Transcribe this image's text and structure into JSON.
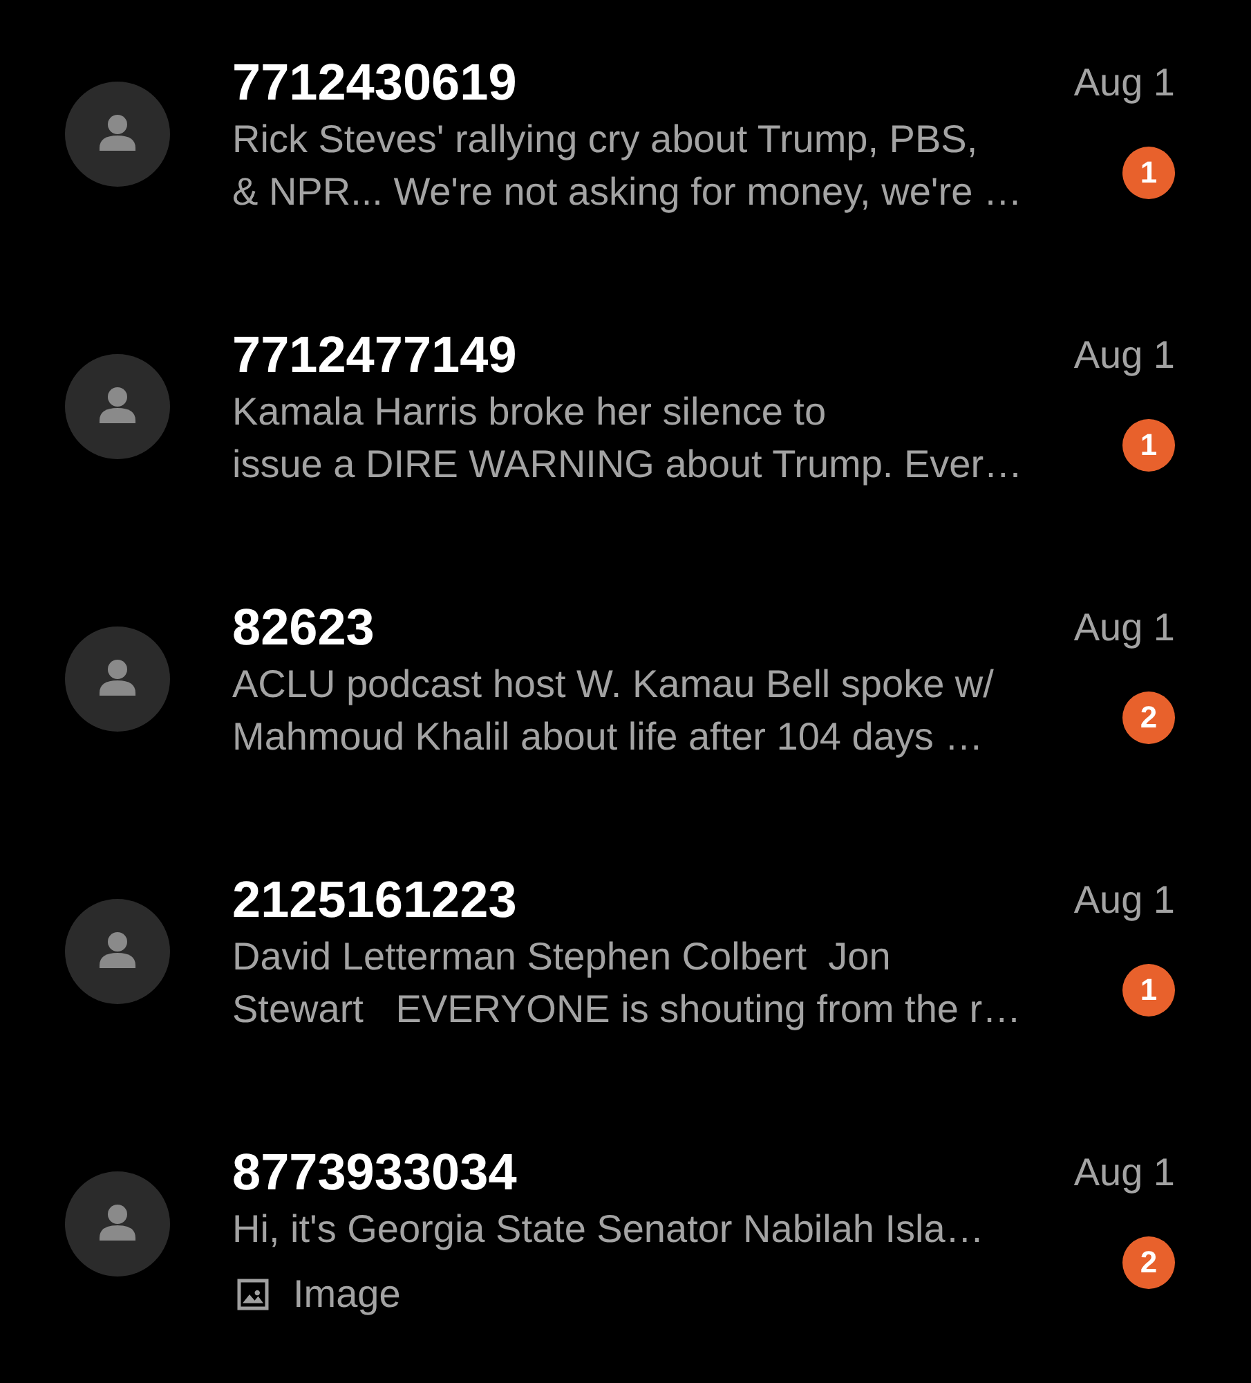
{
  "conversations": [
    {
      "sender": "7712430619",
      "date": "Aug 1",
      "preview_lines": [
        "Rick Steves' rallying cry about Trump, PBS,",
        "& NPR... We're not asking for money, we're …"
      ],
      "unread": "1"
    },
    {
      "sender": "7712477149",
      "date": "Aug 1",
      "preview_lines": [
        "Kamala Harris broke her silence to",
        "issue a DIRE WARNING about Trump. Ever…"
      ],
      "unread": "1"
    },
    {
      "sender": "82623",
      "date": "Aug 1",
      "preview_lines": [
        "ACLU podcast host W. Kamau Bell spoke w/",
        "Mahmoud Khalil about life after 104 days …"
      ],
      "unread": "2"
    },
    {
      "sender": "2125161223",
      "date": "Aug 1",
      "preview_lines": [
        "David Letterman Stephen Colbert  Jon",
        "Stewart   EVERYONE is shouting from the r…"
      ],
      "unread": "1"
    },
    {
      "sender": "8773933034",
      "date": "Aug 1",
      "preview_lines": [
        "Hi, it's Georgia State Senator Nabilah Isla…"
      ],
      "attachment": {
        "kind": "image",
        "label": "Image"
      },
      "unread": "2"
    }
  ]
}
